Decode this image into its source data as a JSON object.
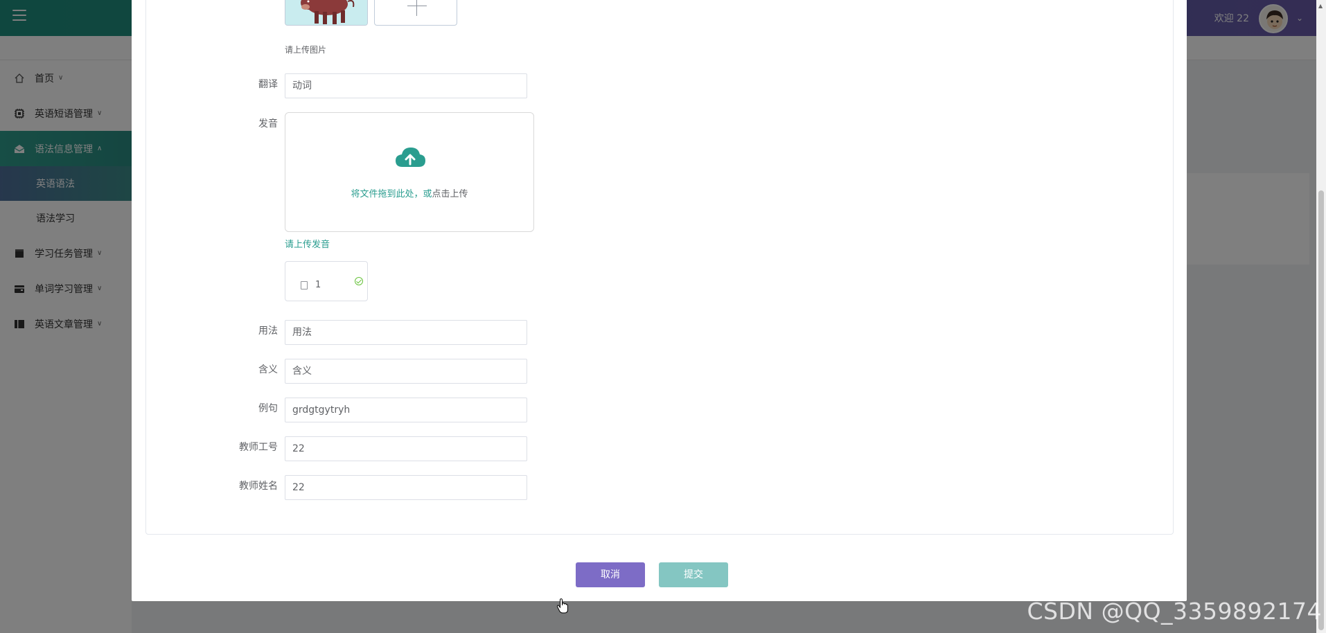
{
  "header": {
    "welcome": "欢迎 22"
  },
  "sidebar": {
    "items": [
      {
        "label": "首页"
      },
      {
        "label": "英语短语管理"
      },
      {
        "label": "语法信息管理"
      },
      {
        "label": "学习任务管理"
      },
      {
        "label": "单词学习管理"
      },
      {
        "label": "英语文章管理"
      }
    ],
    "subitems": [
      {
        "label": "英语语法"
      },
      {
        "label": "语法学习"
      }
    ]
  },
  "form": {
    "image_hint": "请上传图片",
    "translate": {
      "label": "翻译",
      "value": "动词"
    },
    "audio": {
      "label": "发音",
      "drop_text_a": "将文件拖到此处，或",
      "drop_text_b": "点击上传",
      "tip": "请上传发音",
      "file_name": "1"
    },
    "usage": {
      "label": "用法",
      "value": "用法"
    },
    "meaning": {
      "label": "含义",
      "value": "含义"
    },
    "example": {
      "label": "例句",
      "value": "grdgtgytryh"
    },
    "teacher_id": {
      "label": "教师工号",
      "value": "22"
    },
    "teacher_name": {
      "label": "教师姓名",
      "value": "22"
    }
  },
  "buttons": {
    "cancel": "取消",
    "submit": "提交"
  },
  "watermark": "CSDN @QQ_3359892174",
  "colors": {
    "accent": "#2a9d8f",
    "cancel_button": "#7d6cc6",
    "submit_button": "#84c6c2"
  }
}
